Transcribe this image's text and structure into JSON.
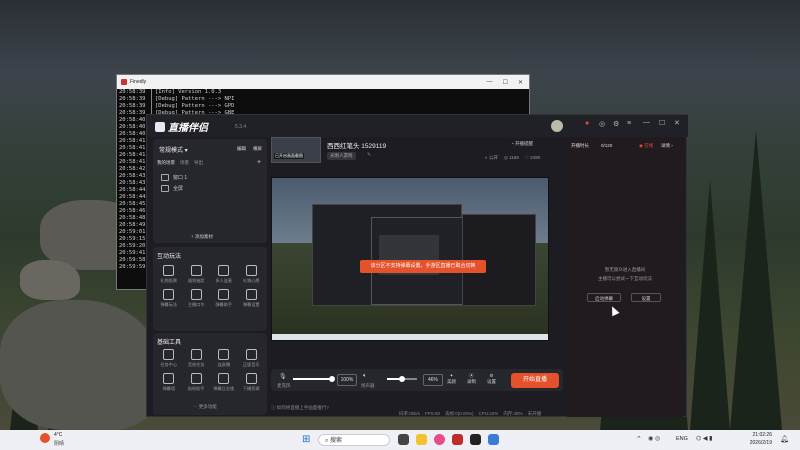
{
  "console": {
    "title": "Finedly",
    "lines": [
      {
        "ts": "20:58:39",
        "msg": "[Info] Version 1.0.3"
      },
      {
        "ts": "20:58:39",
        "msg": "[Debug] Pattern ---> NPI"
      },
      {
        "ts": "20:58:39",
        "msg": "[Debug] Pattern ---> GPD"
      },
      {
        "ts": "20:58:39",
        "msg": "[Debug] Pattern ---> GBE"
      },
      {
        "ts": "20:58:40",
        "msg": ""
      },
      {
        "ts": "20:58:40",
        "msg": ""
      },
      {
        "ts": "20:58:40",
        "msg": ""
      },
      {
        "ts": "20:58:41",
        "msg": ""
      },
      {
        "ts": "20:58:41",
        "msg": ""
      },
      {
        "ts": "20:58:41",
        "msg": ""
      },
      {
        "ts": "20:58:41",
        "msg": ""
      },
      {
        "ts": "20:58:42",
        "msg": ""
      },
      {
        "ts": "20:58:43",
        "msg": ""
      },
      {
        "ts": "20:58:43",
        "msg": ""
      },
      {
        "ts": "20:58:44",
        "msg": ""
      },
      {
        "ts": "20:58:44",
        "msg": ""
      },
      {
        "ts": "20:58:45",
        "msg": ""
      },
      {
        "ts": "20:58:46",
        "msg": ""
      },
      {
        "ts": "20:58:48",
        "msg": ""
      },
      {
        "ts": "20:58:49",
        "msg": ""
      },
      {
        "ts": "20:59:01",
        "msg": ""
      },
      {
        "ts": "20:59:15",
        "msg": ""
      },
      {
        "ts": "20:59:20",
        "msg": ""
      },
      {
        "ts": "20:59:41",
        "msg": ""
      },
      {
        "ts": "20:59:58",
        "msg": ""
      },
      {
        "ts": "20:59:59",
        "msg": ""
      }
    ]
  },
  "app": {
    "logo": "直播伴侣",
    "version": "5.3.4",
    "mode_label": "常规模式",
    "edit_label": "编辑",
    "landscape_label": "横屏",
    "source_tabs": [
      "我的场景",
      "场景",
      "导出"
    ],
    "sources": [
      "窗口 1",
      "全屏"
    ],
    "add_source": "添加素材",
    "interactive_title": "互动玩法",
    "interactive": [
      "礼物投票",
      "福袋抽奖",
      "多人连麦",
      "礼物心愿",
      "弹幕玩法",
      "主播口令",
      "弹幕助手",
      "弹幕设置"
    ],
    "basic_title": "基础工具",
    "basic": [
      "任务中心",
      "音效任务",
      "连屏播",
      "正版音乐",
      "弹幕墙",
      "贴纸助手",
      "弹幕日志锁",
      "下播剪辑"
    ],
    "more": "更多功能",
    "room_title": "西西红笔头 1529119",
    "room_tag": "光明人游戏",
    "thumb_label": "已开启画面截图",
    "toolbar_right": [
      "开播提醒",
      "分享"
    ],
    "stats": [
      "公开",
      "1169",
      "2490"
    ],
    "toast": "该分区不支持弹幕设置，手游区直播已取合切换",
    "mic_label": "麦克风",
    "mic_pct": "100%",
    "speaker_label": "扬声器",
    "speaker_pct": "46%",
    "tools": [
      "美颜",
      "录制",
      "设置"
    ],
    "start_btn": "开始直播",
    "status_hint": "如何将直播上手画面推行?",
    "status_items": [
      "码率:0kb/s",
      "FPS:60",
      "丢帧:0(0.00%)",
      "CPU:22%",
      "内存:48%",
      "未开播"
    ],
    "chat_tabs": [
      "开播时长",
      "0/120"
    ],
    "chat_status": "在线",
    "chat_detail": "详情",
    "chat_empty1": "暂无观众进入直播间",
    "chat_empty2": "主播可以尝试一下互动玩法",
    "chat_btns": [
      "启动弹幕",
      "设置"
    ]
  },
  "taskbar": {
    "weather_temp": "4°C",
    "weather_desc": "阴晴",
    "search": "搜索",
    "lang": "ENG",
    "time": "21:02:26",
    "date": "2026/2/19"
  },
  "colors": {
    "accent": "#e4512b",
    "app_bg": "#1c1c22"
  }
}
